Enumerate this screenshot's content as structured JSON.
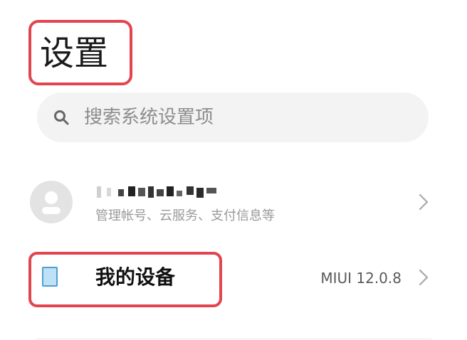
{
  "header": {
    "title": "设置"
  },
  "search": {
    "placeholder": "搜索系统设置项",
    "icon": "search-icon"
  },
  "account": {
    "name_obscured": true,
    "subtitle": "管理帐号、云服务、支付信息等",
    "avatar_icon": "user-avatar-icon"
  },
  "device": {
    "label": "我的设备",
    "value": "MIUI 12.0.8",
    "icon": "phone-icon"
  },
  "colors": {
    "highlight": "#e3454f",
    "search_bg": "#f3f3f3",
    "subtitle": "#9a9a9a",
    "device_icon_fill": "#bfe1f5",
    "device_icon_stroke": "#4f9fd3"
  }
}
